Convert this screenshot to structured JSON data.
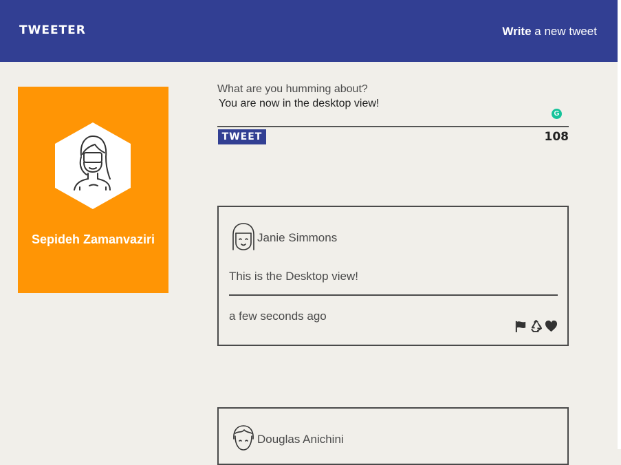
{
  "nav": {
    "brand": "TWEETER",
    "write_bold": "Write",
    "write_rest": " a new tweet"
  },
  "profile": {
    "name": "Sepideh Zamanvaziri"
  },
  "composer": {
    "label": "What are you humming about?",
    "value": "You are now in the desktop view!",
    "button_label": "TWEET",
    "counter": "108"
  },
  "tweets": [
    {
      "author": "Janie Simmons",
      "body": "This is the Desktop view!",
      "time": "a few seconds ago",
      "actions": [
        "flag-icon",
        "retweet-icon",
        "heart-icon"
      ]
    },
    {
      "author": "Douglas Anichini"
    }
  ],
  "colors": {
    "nav_bg": "#323f93",
    "profile_bg": "#ff9505",
    "page_bg": "#f1efea",
    "grammarly": "#15c39a"
  }
}
